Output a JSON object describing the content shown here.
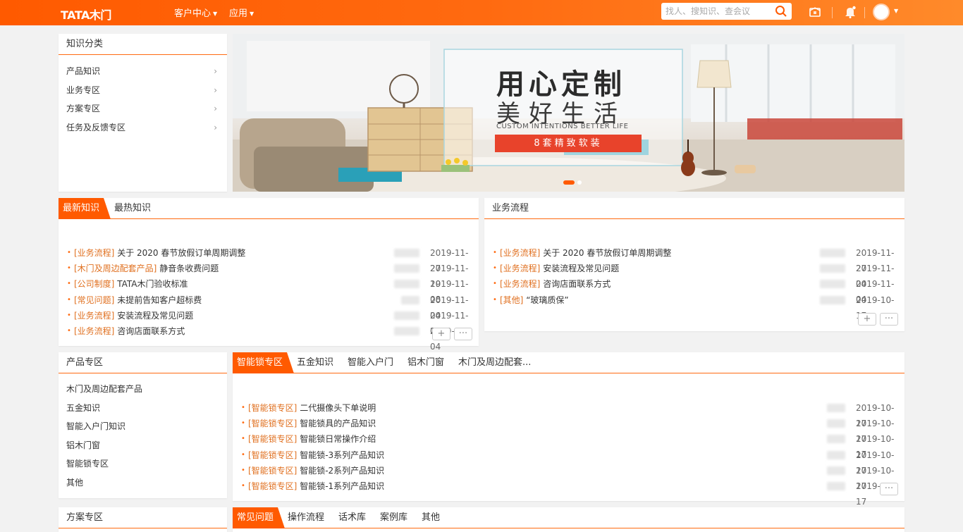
{
  "topbar": {
    "logo": "TATA木门",
    "nav": [
      {
        "label": "客户中心"
      },
      {
        "label": "应用"
      }
    ],
    "search_placeholder": "找人、搜知识、查会议",
    "icons": [
      "cube-icon",
      "bell-icon",
      "avatar"
    ]
  },
  "knowledge_category": {
    "title": "知识分类",
    "items": [
      "产品知识",
      "业务专区",
      "方案专区",
      "任务及反馈专区"
    ]
  },
  "banner": {
    "headline": "用心定制",
    "subline": "美好生活",
    "english": "CUSTOM INTENTIONS BETTER LIFE",
    "ribbon": "8套精致软装"
  },
  "news": {
    "tabs": [
      "最新知识",
      "最热知识"
    ],
    "rows": [
      {
        "tag": "[业务流程]",
        "title": "关于 2020 春节放假订单周期调整",
        "date": "2019-11-27"
      },
      {
        "tag": "[木门及周边配套产品]",
        "title": "静音条收费问题",
        "date": "2019-11-19"
      },
      {
        "tag": "[公司制度]",
        "title": "TATA木门验收标准",
        "date": "2019-11-08"
      },
      {
        "tag": "[常见问题]",
        "title": "未提前告知客户超标费",
        "date": "2019-11-04"
      },
      {
        "tag": "[业务流程]",
        "title": "安装流程及常见问题",
        "date": "2019-11-04"
      },
      {
        "tag": "[业务流程]",
        "title": "咨询店面联系方式",
        "date": "2019-11-04"
      }
    ],
    "add": "+",
    "more": "···"
  },
  "process": {
    "title": "业务流程",
    "rows": [
      {
        "tag": "[业务流程]",
        "title": "关于 2020 春节放假订单周期调整",
        "date": "2019-11-27"
      },
      {
        "tag": "[业务流程]",
        "title": "安装流程及常见问题",
        "date": "2019-11-04"
      },
      {
        "tag": "[业务流程]",
        "title": "咨询店面联系方式",
        "date": "2019-11-04"
      },
      {
        "tag": "[其他]",
        "title": "“玻璃质保”",
        "date": "2019-10-17"
      }
    ],
    "add": "+",
    "more": "···"
  },
  "product_zone": {
    "title": "产品专区",
    "items": [
      "木门及周边配套产品",
      "五金知识",
      "智能入户门知识",
      "铝木门窗",
      "智能锁专区",
      "其他"
    ]
  },
  "lock_zone": {
    "tabs": [
      "智能锁专区",
      "五金知识",
      "智能入户门",
      "铝木门窗",
      "木门及周边配套..."
    ],
    "rows": [
      {
        "tag": "[智能锁专区]",
        "title": "二代摄像头下单说明",
        "date": "2019-10-17"
      },
      {
        "tag": "[智能锁专区]",
        "title": "智能锁具的产品知识",
        "date": "2019-10-17"
      },
      {
        "tag": "[智能锁专区]",
        "title": "智能锁日常操作介绍",
        "date": "2019-10-17"
      },
      {
        "tag": "[智能锁专区]",
        "title": "智能锁-3系列产品知识",
        "date": "2019-10-17"
      },
      {
        "tag": "[智能锁专区]",
        "title": "智能锁-2系列产品知识",
        "date": "2019-10-17"
      },
      {
        "tag": "[智能锁专区]",
        "title": "智能锁-1系列产品知识",
        "date": "2019-10-17"
      }
    ],
    "more": "···"
  },
  "plan_zone": {
    "title": "方案专区"
  },
  "faq": {
    "tabs": [
      "常见问题",
      "操作流程",
      "话术库",
      "案例库",
      "其他"
    ]
  },
  "colors": {
    "accent": "#ff5a00",
    "tag": "#e07020"
  }
}
